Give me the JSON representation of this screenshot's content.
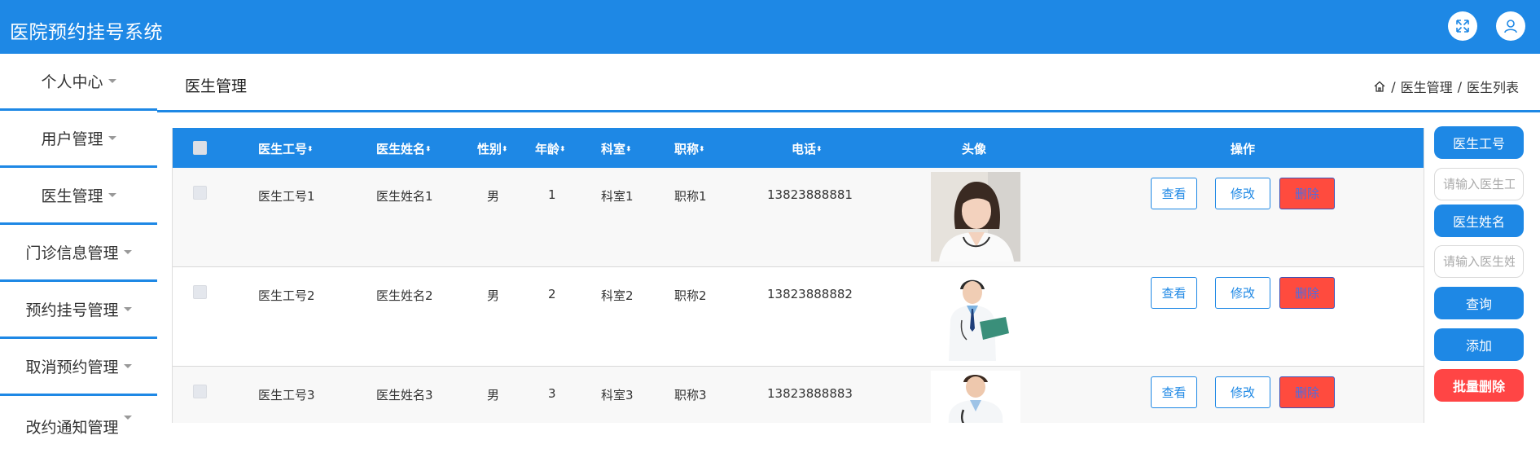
{
  "header": {
    "title": "医院预约挂号系统",
    "icons": [
      "fullscreen-icon",
      "user-icon"
    ]
  },
  "sidebar": {
    "items": [
      {
        "label": "个人中心"
      },
      {
        "label": "用户管理"
      },
      {
        "label": "医生管理"
      },
      {
        "label": "门诊信息管理"
      },
      {
        "label": "预约挂号管理"
      },
      {
        "label": "取消预约管理"
      },
      {
        "label": "改约通知管理"
      }
    ]
  },
  "main": {
    "title": "医生管理",
    "breadcrumb": [
      "医生管理",
      "医生列表"
    ],
    "breadcrumb_sep": "/"
  },
  "table": {
    "columns": {
      "id": "医生工号",
      "name": "医生姓名",
      "gender": "性别",
      "age": "年龄",
      "dept": "科室",
      "title": "职称",
      "phone": "电话",
      "avatar": "头像",
      "ops": "操作"
    },
    "sort_glyph": "⬍",
    "rows": [
      {
        "id": "医生工号1",
        "name": "医生姓名1",
        "gender": "男",
        "age": "1",
        "dept": "科室1",
        "title": "职称1",
        "phone": "13823888881",
        "avatar": "female-doctor-photo"
      },
      {
        "id": "医生工号2",
        "name": "医生姓名2",
        "gender": "男",
        "age": "2",
        "dept": "科室2",
        "title": "职称2",
        "phone": "13823888882",
        "avatar": "male-doctor-clipboard-photo"
      },
      {
        "id": "医生工号3",
        "name": "医生姓名3",
        "gender": "男",
        "age": "3",
        "dept": "科室3",
        "title": "职称3",
        "phone": "13823888883",
        "avatar": "male-doctor-stethoscope-photo"
      }
    ],
    "actions": {
      "view": "查看",
      "edit": "修改",
      "delete": "删除"
    }
  },
  "search": {
    "id_label": "医生工号",
    "id_placeholder": "请输入医生工号",
    "name_label": "医生姓名",
    "name_placeholder": "请输入医生姓名",
    "query": "查询",
    "add": "添加",
    "batch_delete": "批量删除"
  },
  "colors": {
    "primary": "#1e88e5",
    "danger": "#ff4545"
  }
}
